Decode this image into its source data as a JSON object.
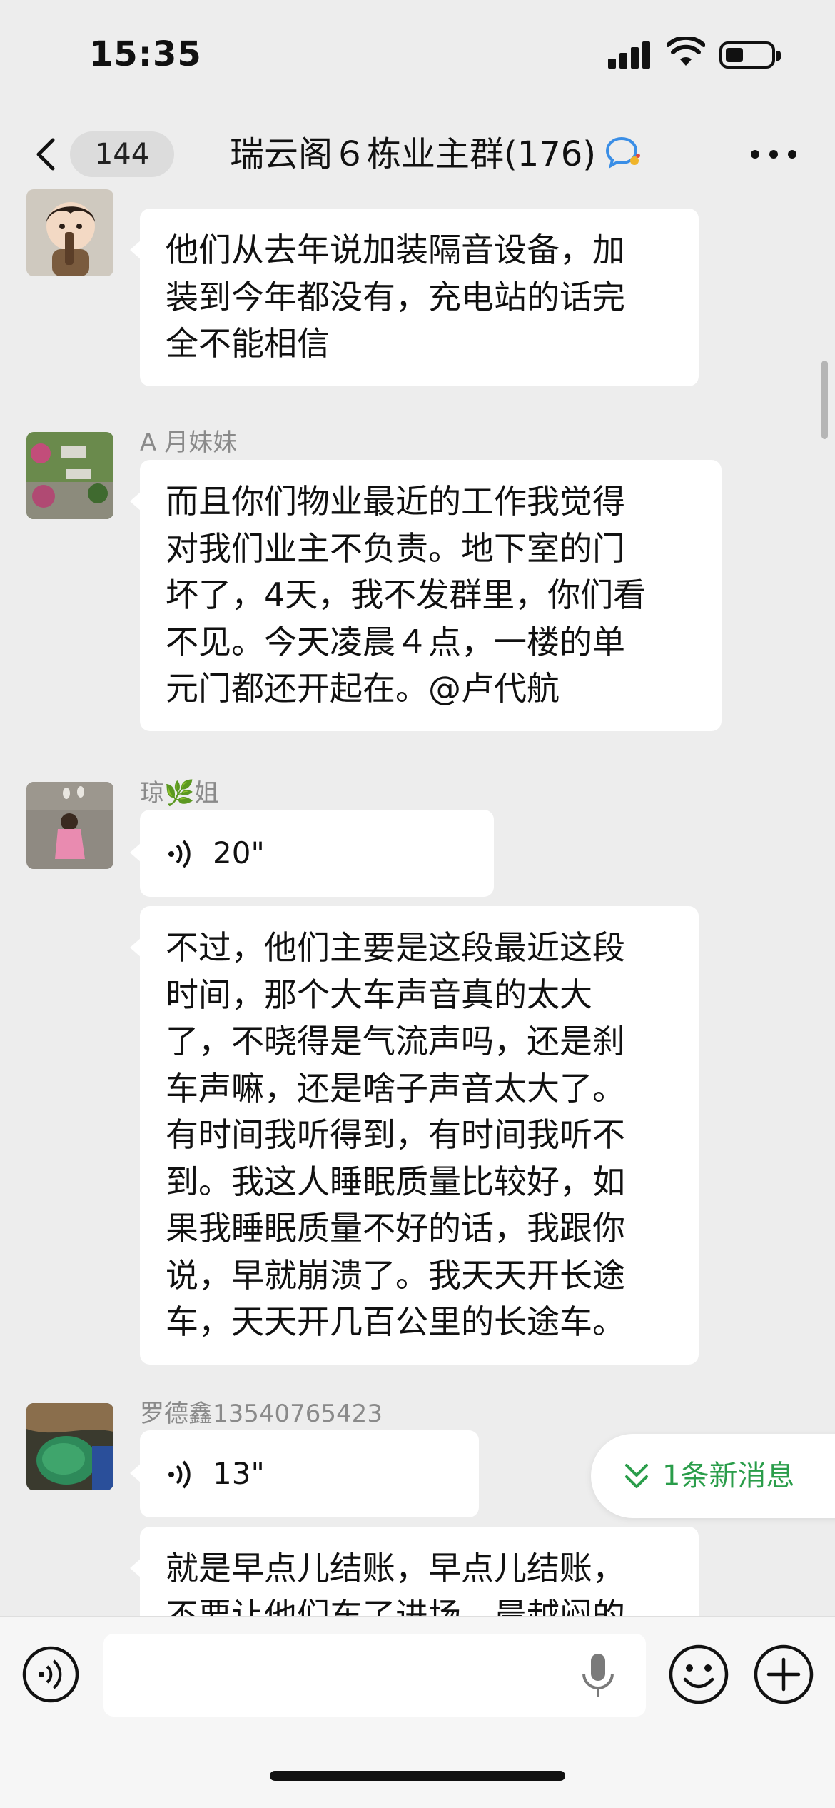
{
  "status_bar": {
    "time": "15:35"
  },
  "header": {
    "unread_count": "144",
    "title": "瑞云阁６栋业主群(176)"
  },
  "messages": [
    {
      "sender": "",
      "type": "text",
      "text": "他们从去年说加装隔音设备，加\n装到今年都没有，充电站的话完\n全不能相信"
    },
    {
      "sender": "A 月妹妹",
      "type": "text",
      "text": "而且你们物业最近的工作我觉得\n对我们业主不负责。地下室的门\n坏了，4天，我不发群里，你们看\n不见。今天凌晨４点，一楼的单\n元门都还开起在。@卢代航"
    },
    {
      "sender": "琼🌿姐",
      "type": "voice",
      "duration": "20\"",
      "text": "不过，他们主要是这段最近这段\n时间，那个大车声音真的太大\n了，不晓得是气流声吗，还是刹\n车声嘛，还是啥子声音太大了。\n有时间我听得到，有时间我听不\n到。我这人睡眠质量比较好，如\n果我睡眠质量不好的话，我跟你\n说，早就崩溃了。我天天开长途\n车，天天开几百公里的长途车。"
    },
    {
      "sender": "罗德鑫13540765423",
      "type": "voice",
      "duration": "13\"",
      "text": "就是早点儿结账，早点儿结账，\n不要让他们东了进场，晨越闷的"
    }
  ],
  "new_messages_label": "1条新消息",
  "input": {
    "placeholder": ""
  },
  "icons": {
    "back": "chevron-left-icon",
    "chat_bubble": "chat-bubble-icon",
    "more": "more-dots-icon",
    "voice_toggle": "voice-icon",
    "mic": "mic-icon",
    "emoji": "emoji-icon",
    "plus": "plus-icon",
    "double_chevron": "double-chevron-down-icon"
  },
  "colors": {
    "background": "#ededed",
    "bubble": "#ffffff",
    "accent_green": "#2a9d4a"
  }
}
